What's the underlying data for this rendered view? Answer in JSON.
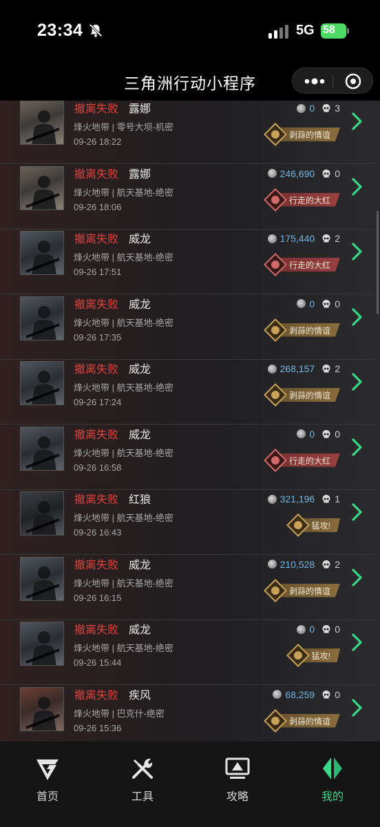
{
  "status_bar": {
    "time": "23:34",
    "network": "5G",
    "battery": "58"
  },
  "nav": {
    "title": "三角洲行动小程序"
  },
  "icons": {
    "bell": "bell-muted-icon",
    "signal": "signal-icon",
    "battery": "battery-charging-icon",
    "more": "more-dots-icon",
    "close": "close-circle-icon",
    "coin": "coin-icon",
    "skull": "skull-icon",
    "chevron": "chevron-right-icon"
  },
  "colors": {
    "fail": "#e0413a",
    "value": "#6fb6e6",
    "accent": "#39d98a",
    "tag_gold": "#8a6d3c",
    "tag_red": "#9a4040"
  },
  "records": [
    {
      "status": "撤离失败",
      "operator": "露娜",
      "map": "烽火地带 | 零号大坝-机密",
      "datetime": "09-26 18:22",
      "value": "0",
      "kills": "3",
      "tag": "剥蒜的情谊",
      "tag_style": "gold",
      "avatar": "luna"
    },
    {
      "status": "撤离失败",
      "operator": "露娜",
      "map": "烽火地带 | 航天基地-绝密",
      "datetime": "09-26 18:06",
      "value": "246,690",
      "kills": "0",
      "tag": "行走的大红",
      "tag_style": "red",
      "avatar": "luna"
    },
    {
      "status": "撤离失败",
      "operator": "威龙",
      "map": "烽火地带 | 航天基地-绝密",
      "datetime": "09-26 17:51",
      "value": "175,440",
      "kills": "2",
      "tag": "行走的大红",
      "tag_style": "red",
      "avatar": "weilong"
    },
    {
      "status": "撤离失败",
      "operator": "威龙",
      "map": "烽火地带 | 航天基地-绝密",
      "datetime": "09-26 17:35",
      "value": "0",
      "kills": "0",
      "tag": "剥蒜的情谊",
      "tag_style": "gold",
      "avatar": "weilong"
    },
    {
      "status": "撤离失败",
      "operator": "威龙",
      "map": "烽火地带 | 航天基地-绝密",
      "datetime": "09-26 17:24",
      "value": "268,157",
      "kills": "2",
      "tag": "剥蒜的情谊",
      "tag_style": "gold",
      "avatar": "weilong"
    },
    {
      "status": "撤离失败",
      "operator": "威龙",
      "map": "烽火地带 | 航天基地-绝密",
      "datetime": "09-26 16:58",
      "value": "0",
      "kills": "0",
      "tag": "行走的大红",
      "tag_style": "red",
      "avatar": "weilong"
    },
    {
      "status": "撤离失败",
      "operator": "红狼",
      "map": "烽火地带 | 航天基地-绝密",
      "datetime": "09-26 16:43",
      "value": "321,196",
      "kills": "1",
      "tag": "猛攻!",
      "tag_style": "gold",
      "avatar": "honglang"
    },
    {
      "status": "撤离失败",
      "operator": "威龙",
      "map": "烽火地带 | 航天基地-绝密",
      "datetime": "09-26 16:15",
      "value": "210,528",
      "kills": "2",
      "tag": "剥蒜的情谊",
      "tag_style": "gold",
      "avatar": "weilong"
    },
    {
      "status": "撤离失败",
      "operator": "威龙",
      "map": "烽火地带 | 航天基地-绝密",
      "datetime": "09-26 15:44",
      "value": "0",
      "kills": "0",
      "tag": "猛攻!",
      "tag_style": "gold",
      "avatar": "weilong"
    },
    {
      "status": "撤离失败",
      "operator": "疾风",
      "map": "烽火地带 | 巴克什-绝密",
      "datetime": "09-26 15:36",
      "value": "68,259",
      "kills": "0",
      "tag": "剥蒜的情谊",
      "tag_style": "gold",
      "avatar": "jifeng"
    }
  ],
  "tabs": [
    {
      "label": "首页",
      "icon": "home-g-icon",
      "active": false
    },
    {
      "label": "工具",
      "icon": "tools-icon",
      "active": false
    },
    {
      "label": "攻略",
      "icon": "guide-monitor-icon",
      "active": false
    },
    {
      "label": "我的",
      "icon": "profile-icon",
      "active": true
    }
  ]
}
